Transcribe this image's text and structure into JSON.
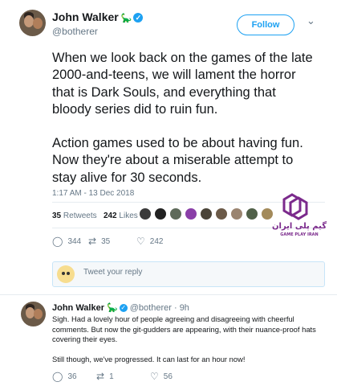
{
  "author": {
    "name": "John Walker",
    "handle": "@botherer",
    "follow_label": "Follow"
  },
  "tweet": {
    "paragraphs": [
      "When we look back on the games of the late 2000-and-teens, we will lament the horror that is Dark Souls, and everything that bloody series did to ruin fun.",
      "Action games used to be about having fun. Now they're about a miserable attempt to stay alive for 30 seconds."
    ],
    "timestamp": "1:17 AM - 13 Dec 2018",
    "retweets_count": "35",
    "retweets_label": "Retweets",
    "likes_count": "242",
    "likes_label": "Likes",
    "replies_count": "344",
    "retweets_action": "35",
    "likes_action": "242"
  },
  "reply_box": {
    "placeholder": "Tweet your reply"
  },
  "reply": {
    "name": "John Walker",
    "handle": "@botherer",
    "age": "· 9h",
    "paragraphs": [
      "Sigh. Had a lovely hour of people agreeing and disagreeing with cheerful comments. But now the git-gudders are appearing, with their nuance-proof hats covering their eyes.",
      "Still though, we've progressed. It can last for an hour now!"
    ],
    "replies_count": "36",
    "retweets_count": "1",
    "likes_count": "56"
  },
  "watermark": {
    "text_fa": "گیم پلی ایران",
    "text_en": "GAME PLAY IRAN",
    "color": "#7b2a8c"
  },
  "colors": {
    "accent": "#1da1f2",
    "muted": "#657786",
    "text": "#14171a"
  },
  "icons": {
    "reply": "reply-icon",
    "retweet": "retweet-icon",
    "like": "heart-icon",
    "verified": "verified-badge-icon",
    "chevron": "chevron-down-icon"
  }
}
